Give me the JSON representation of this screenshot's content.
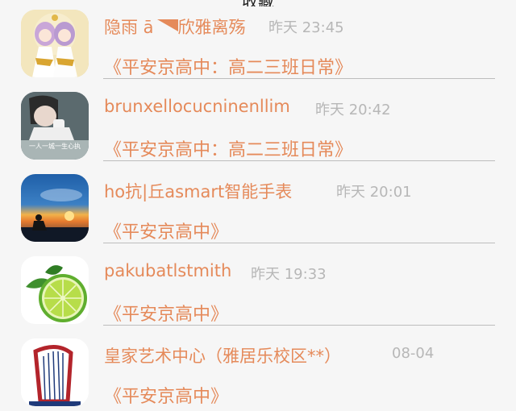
{
  "header": {
    "title": "收藏"
  },
  "items": [
    {
      "name": "隐雨 ā",
      "name_suffix": "欣雅离殇",
      "time": "昨天 23:45",
      "message": "《平安京高中：高二三班日常》"
    },
    {
      "name": "brunxellocucninenllim",
      "time": "昨天 20:42",
      "message": "《平安京高中：高二三班日常》",
      "avatar_caption": "一人一城一生心执"
    },
    {
      "name": "ho抗|丘asmart智能手表",
      "time": "昨天 20:01",
      "message": "《平安京高中》"
    },
    {
      "name": "pakubatlstmith",
      "time": "昨天 19:33",
      "message": "《平安京高中》"
    },
    {
      "name": "皇家艺术中心（雅居乐校区**）",
      "time": "08-04",
      "message": "《平安京高中》"
    }
  ],
  "colors": {
    "accent": "#e58a5a",
    "time": "#b7b7b7",
    "background": "#f6f6f6"
  }
}
